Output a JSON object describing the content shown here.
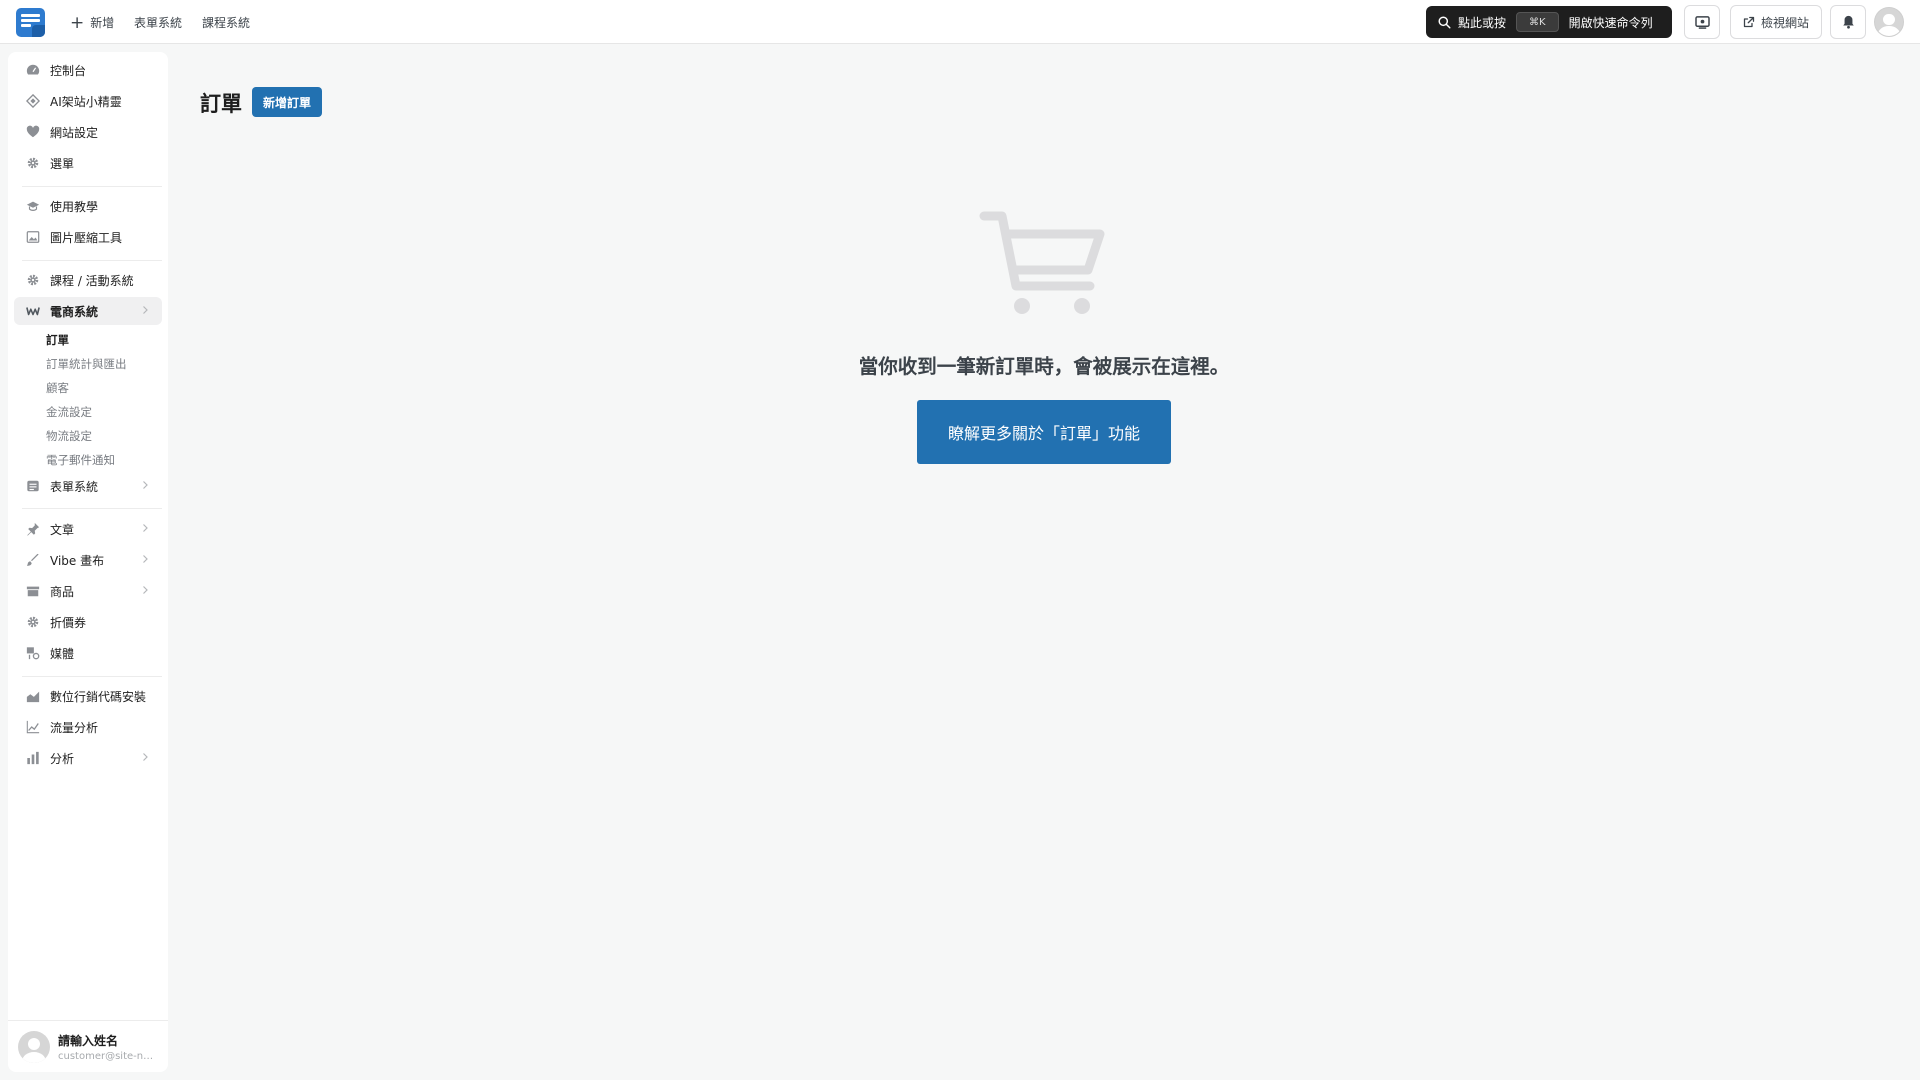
{
  "topbar": {
    "new_label": "新增",
    "forms_label": "表單系統",
    "courses_label": "課程系統",
    "command": {
      "prefix": "點此或按",
      "shortcut": "⌘K",
      "suffix": "開啟快速命令列"
    },
    "view_site_label": "檢視網站"
  },
  "sidebar": {
    "group1": [
      {
        "label": "控制台",
        "icon": "dashboard-icon"
      },
      {
        "label": "AI架站小精靈",
        "icon": "ai-wizard-icon"
      },
      {
        "label": "網站設定",
        "icon": "heart-icon"
      },
      {
        "label": "選單",
        "icon": "gear-icon"
      }
    ],
    "group2": [
      {
        "label": "使用教學",
        "icon": "graduation-cap-icon"
      },
      {
        "label": "圖片壓縮工具",
        "icon": "image-compress-icon"
      }
    ],
    "group3": [
      {
        "label": "課程 / 活動系統",
        "icon": "gear-icon"
      },
      {
        "label": "電商系統",
        "icon": "woo-icon"
      }
    ],
    "ecommerce_sub": [
      {
        "label": "訂單"
      },
      {
        "label": "訂單統計與匯出"
      },
      {
        "label": "顧客"
      },
      {
        "label": "金流設定"
      },
      {
        "label": "物流設定"
      },
      {
        "label": "電子郵件通知"
      }
    ],
    "forms": {
      "label": "表單系統",
      "icon": "form-icon"
    },
    "group4": [
      {
        "label": "文章",
        "icon": "pin-icon"
      },
      {
        "label": "Vibe 畫布",
        "icon": "brush-icon"
      },
      {
        "label": "商品",
        "icon": "archive-icon"
      },
      {
        "label": "折價券",
        "icon": "gear-icon"
      },
      {
        "label": "媒體",
        "icon": "media-icon"
      }
    ],
    "group5": [
      {
        "label": "數位行銷代碼安裝",
        "icon": "area-chart-icon"
      },
      {
        "label": "流量分析",
        "icon": "line-chart-icon"
      },
      {
        "label": "分析",
        "icon": "bar-chart-icon"
      }
    ],
    "user": {
      "name": "請輸入姓名",
      "email": "customer@site-name.com"
    }
  },
  "main": {
    "title": "訂單",
    "add_button": "新增訂單",
    "empty_message": "當你收到一筆新訂單時，會被展示在這裡。",
    "learn_more_button": "瞭解更多關於「訂單」功能"
  },
  "colors": {
    "accent": "#2271b1",
    "logo": "#2e7bcf",
    "dark_button": "#1e1e1e",
    "background": "#f6f7f7"
  }
}
